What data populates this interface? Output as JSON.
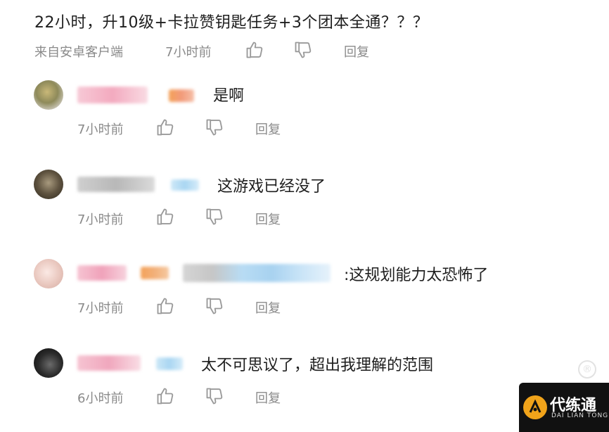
{
  "post": {
    "text": "22小时，升10级+卡拉赞钥匙任务+3个团本全通？？？",
    "source": "来自安卓客户端",
    "time": "7小时前",
    "reply_label": "回复"
  },
  "comments": [
    {
      "text": "是啊",
      "time": "7小时前",
      "reply_label": "回复"
    },
    {
      "text": "这游戏已经没了",
      "time": "7小时前",
      "reply_label": "回复"
    },
    {
      "text": ":这规划能力太恐怖了",
      "time": "7小时前",
      "reply_label": "回复"
    },
    {
      "text": "太不可思议了，超出我理解的范围",
      "time": "6小时前",
      "reply_label": "回复"
    }
  ],
  "icons": {
    "like": "thumbs-up-icon",
    "dislike": "thumbs-down-icon"
  },
  "colors": {
    "text": "#1e1e1e",
    "meta": "#8a8a8a",
    "brand_bg": "#111111",
    "brand_accent": "#f0a31a"
  },
  "brand": {
    "name": "代练通",
    "sub": "DAI LIAN TONG"
  }
}
